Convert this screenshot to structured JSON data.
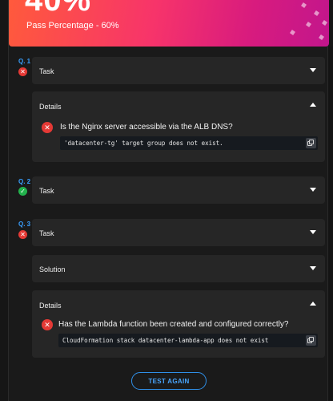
{
  "header": {
    "score": "40%",
    "pass_percentage": "Pass Percentage - 60%"
  },
  "questions": [
    {
      "number": "Q. 1",
      "status": "fail",
      "status_icon": "close-icon",
      "task_label": "Task",
      "details_label": "Details",
      "detail_question": "Is the Nginx server accessible via the ALB DNS?",
      "detail_code": "'datacenter-tg' target group does not exist."
    },
    {
      "number": "Q. 2",
      "status": "pass",
      "status_icon": "check-icon",
      "task_label": "Task"
    },
    {
      "number": "Q. 3",
      "status": "fail",
      "status_icon": "close-icon",
      "task_label": "Task",
      "solution_label": "Solution",
      "details_label": "Details",
      "detail_question": "Has the Lambda function been created and configured correctly?",
      "detail_code": "CloudFormation stack datacenter-lambda-app does not exist"
    }
  ],
  "actions": {
    "test_again": "TEST AGAIN"
  },
  "colors": {
    "banner_start": "#ff5a3c",
    "banner_end": "#c2168c",
    "fail": "#e53935",
    "pass": "#22b24c",
    "accent": "#3aa0ff"
  }
}
